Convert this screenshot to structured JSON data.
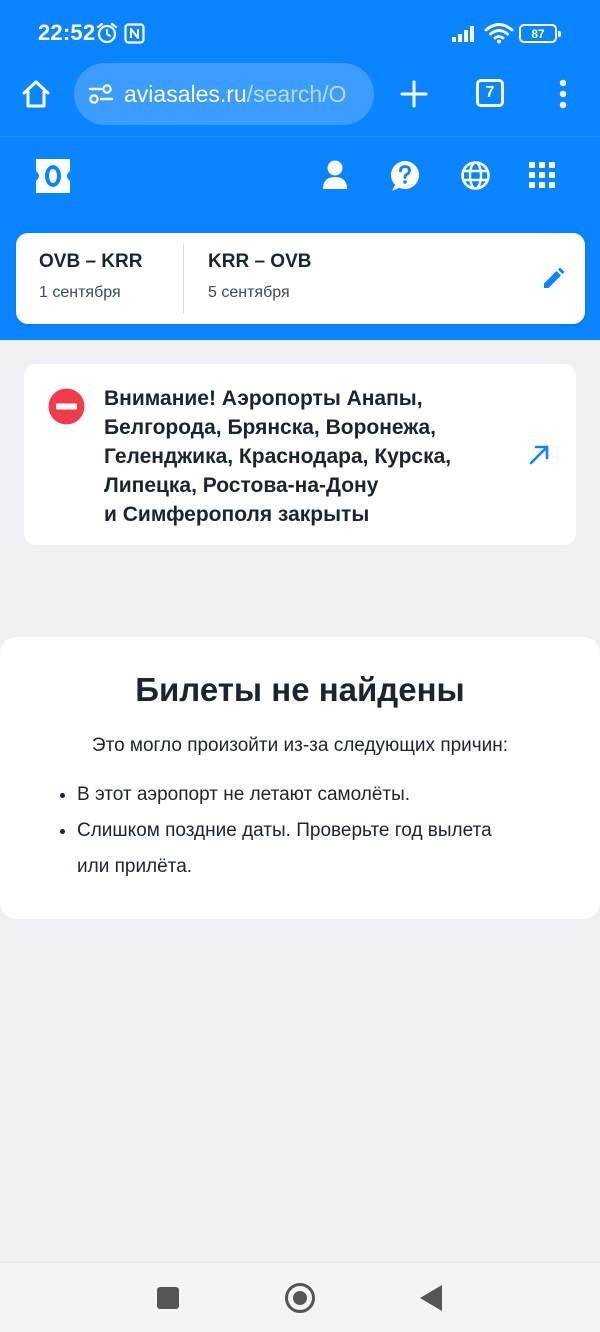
{
  "status_bar": {
    "time": "22:52",
    "battery": "87"
  },
  "browser": {
    "url_domain": "aviasales.ru",
    "url_path": "/search/O",
    "tab_count": "7"
  },
  "route": {
    "outbound": {
      "code": "OVB – KRR",
      "date": "1 сентября"
    },
    "return": {
      "code": "KRR – OVB",
      "date": "5 сентября"
    }
  },
  "alert": {
    "lines": [
      "Внимание! Аэропорты Анапы,",
      "Белгорода, Брянска, Воронежа,",
      "Геленджика, Краснодара, Курска,",
      "Липецка, Ростова-на-Дону",
      "и Симферополя закрыты"
    ]
  },
  "not_found": {
    "title": "Билеты не найдены",
    "subtitle": "Это могло произойти из-за следующих причин:",
    "reasons": [
      "В этот аэропорт не летают самолёты.",
      "Слишком поздние даты. Проверьте год вылета или прилёта."
    ]
  },
  "colors": {
    "brand_blue": "#0a84ff",
    "alert_red": "#ef3b4c",
    "background": "#efeff4"
  },
  "icons": {
    "status": [
      "alarm-icon",
      "nfc-icon",
      "signal-icon",
      "wifi-icon",
      "battery-icon"
    ],
    "browser": [
      "home-icon",
      "site-settings-icon",
      "new-tab-icon",
      "tabs-icon",
      "more-icon"
    ],
    "header": [
      "aviasales-logo",
      "profile-icon",
      "help-icon",
      "language-icon",
      "apps-icon"
    ],
    "route": [
      "edit-icon"
    ],
    "alert": [
      "no-entry-icon",
      "external-link-icon"
    ],
    "nav": [
      "recents-icon",
      "home-circle-icon",
      "back-icon"
    ]
  }
}
